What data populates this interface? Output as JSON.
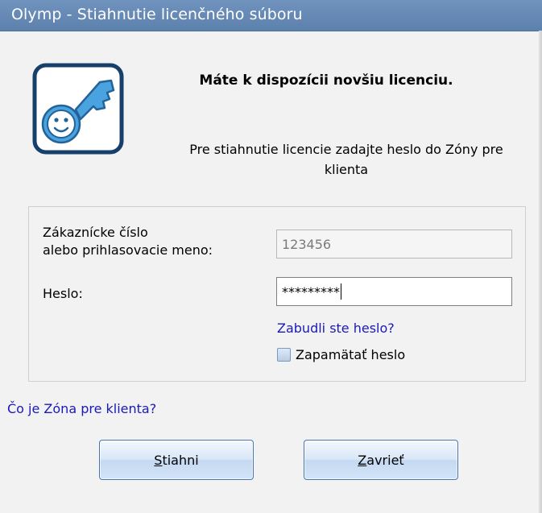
{
  "window": {
    "title": "Olymp - Stiahnutie licenčného súboru"
  },
  "icon": {
    "name": "key-icon",
    "colors": {
      "frame": "#173f6b",
      "key": "#4aa3de",
      "key_outline": "#23639a"
    }
  },
  "header": {
    "headline": "Máte k dispozícii novšiu licenciu.",
    "instruction": "Pre stiahnutie licencie  zadajte heslo do Zóny pre klienta"
  },
  "form": {
    "customer_label_line1": "Zákaznícke číslo",
    "customer_label_line2": "alebo prihlasovacie meno:",
    "customer_value": "123456",
    "password_label": "Heslo:",
    "password_value": "*********",
    "forgot_link": "Zabudli ste heslo?",
    "remember_label": "Zapamätať heslo",
    "remember_checked": false
  },
  "footer": {
    "info_link": "Čo je Zóna pre klienta?"
  },
  "buttons": {
    "download_accel": "S",
    "download_rest": "tiahni",
    "close_accel": "Z",
    "close_rest": "avrieť"
  },
  "colors": {
    "titlebar": "#6589b4",
    "link": "#1a1ab8",
    "button_border": "#4a76ad"
  }
}
